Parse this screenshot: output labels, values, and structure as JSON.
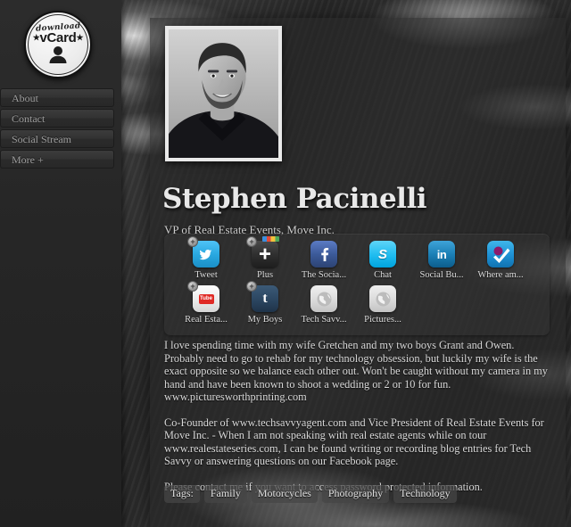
{
  "sidebar": {
    "vcard": {
      "download_label": "download",
      "title": "vCard",
      "star": "★",
      "person_icon": "person-silhouette-icon"
    },
    "menu": [
      {
        "label": "About"
      },
      {
        "label": "Contact"
      },
      {
        "label": "Social Stream"
      },
      {
        "label": "More +"
      }
    ]
  },
  "profile": {
    "photo_alt": "profile-photo",
    "name": "Stephen Pacinelli",
    "tagline": "VP of Real Estate Events, Move Inc."
  },
  "social": {
    "badge_symbol": "+",
    "items": [
      {
        "label": "Tweet",
        "icon": "twitter-icon",
        "skin": "ic-twitter",
        "glyph": "t",
        "badge": true
      },
      {
        "label": "Plus",
        "icon": "google-plus-icon",
        "skin": "ic-gplus",
        "glyph": "+",
        "badge": true
      },
      {
        "label": "The Socia...",
        "icon": "facebook-icon",
        "skin": "ic-facebook",
        "glyph": "f",
        "badge": false
      },
      {
        "label": "Chat",
        "icon": "skype-icon",
        "skin": "ic-skype",
        "glyph": "S",
        "badge": false
      },
      {
        "label": "Social Bu...",
        "icon": "linkedin-icon",
        "skin": "ic-linkedin",
        "glyph": "in",
        "badge": false
      },
      {
        "label": "Where am...",
        "icon": "foursquare-check-icon",
        "skin": "ic-foursquare",
        "glyph": "",
        "badge": false
      },
      {
        "label": "Real Esta...",
        "icon": "youtube-icon",
        "skin": "ic-youtube",
        "glyph": "",
        "badge": true
      },
      {
        "label": "My Boys",
        "icon": "tumblr-icon",
        "skin": "ic-tumblr",
        "glyph": "t",
        "badge": true
      },
      {
        "label": "Tech Savv...",
        "icon": "globe-icon",
        "skin": "ic-globe",
        "glyph": "",
        "badge": false
      },
      {
        "label": "Pictures...",
        "icon": "globe-icon",
        "skin": "ic-globe",
        "glyph": "",
        "badge": false
      }
    ]
  },
  "bio": {
    "paragraphs": [
      "I love spending time with my wife Gretchen and my two boys Grant and Owen. Probably need to go to rehab for my technology obsession, but luckily my wife is the exact opposite so we balance each other out. Won't be caught without my camera in my hand and have been known to shoot a wedding or 2 or 10 for fun. www.picturesworthprinting.com",
      "Co-Founder of www.techsavvyagent.com and Vice President of Real Estate Events for Move Inc. - When I am not speaking with real estate agents while on tour www.realestateseries.com, I can be found writing or recording blog entries for Tech Savvy or answering questions on our Facebook page.",
      "Please contact me if you want to access password protected information."
    ]
  },
  "tags": {
    "label": "Tags:",
    "items": [
      "Family",
      "Motorcycles",
      "Photography",
      "Technology"
    ]
  },
  "colors": {
    "panel": "#282828",
    "sidebar": "#262626",
    "text": "#d9d9d9",
    "accent_twitter": "#29a8e0",
    "accent_facebook": "#3b5998",
    "accent_youtube": "#e02a25"
  }
}
